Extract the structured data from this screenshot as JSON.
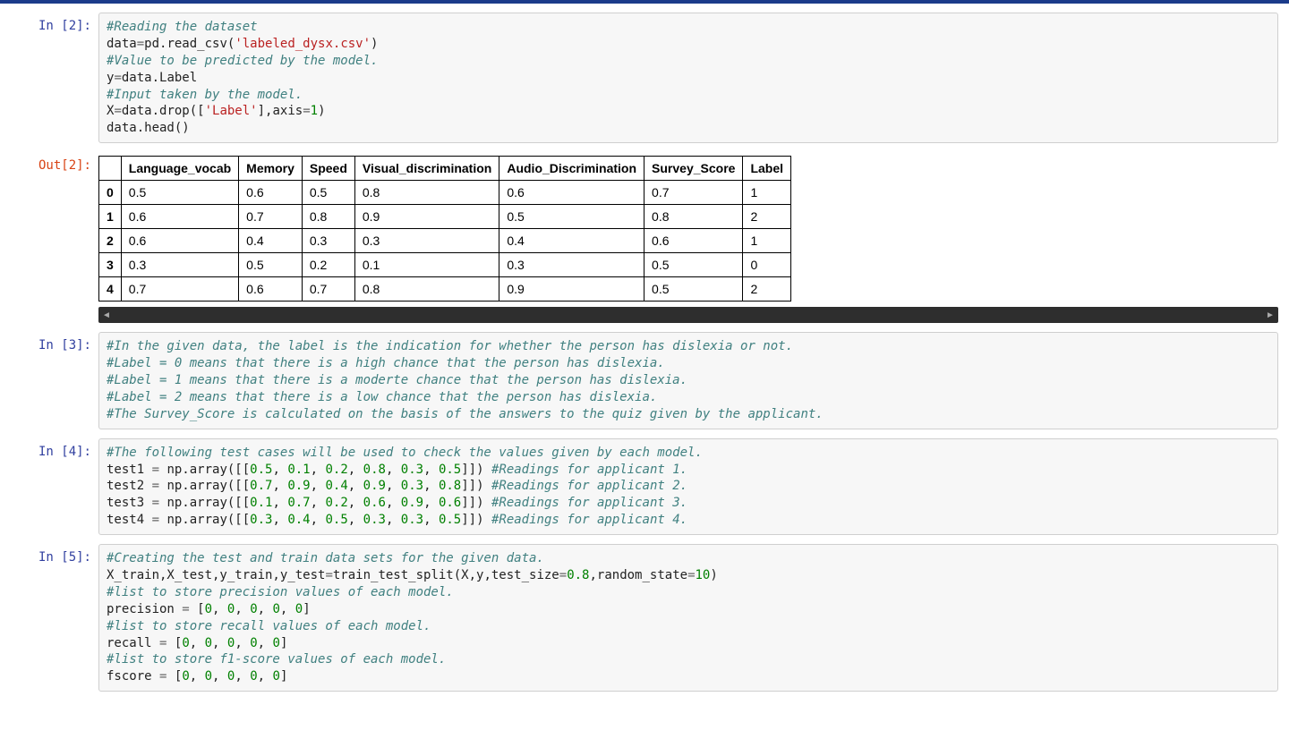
{
  "cells": {
    "in2_prompt": "In [2]:",
    "out2_prompt": "Out[2]:",
    "in3_prompt": "In [3]:",
    "in4_prompt": "In [4]:",
    "in5_prompt": "In [5]:"
  },
  "code2": {
    "l1_comment": "#Reading the dataset",
    "l2_p1": "data",
    "l2_p2": "=",
    "l2_p3": "pd.read_csv(",
    "l2_p4": "'labeled_dysx.csv'",
    "l2_p5": ")",
    "l3_comment": "#Value to be predicted by the model.",
    "l4_p1": "y",
    "l4_p2": "=",
    "l4_p3": "data.Label",
    "l5_comment": "#Input taken by the model.",
    "l6_p1": "X",
    "l6_p2": "=",
    "l6_p3": "data.drop([",
    "l6_p4": "'Label'",
    "l6_p5": "],axis",
    "l6_p6": "=",
    "l6_p7": "1",
    "l6_p8": ")",
    "l7_p1": "data.head()"
  },
  "dataframe": {
    "columns": [
      "Language_vocab",
      "Memory",
      "Speed",
      "Visual_discrimination",
      "Audio_Discrimination",
      "Survey_Score",
      "Label"
    ],
    "index": [
      "0",
      "1",
      "2",
      "3",
      "4"
    ],
    "rows": [
      [
        "0.5",
        "0.6",
        "0.5",
        "0.8",
        "0.6",
        "0.7",
        "1"
      ],
      [
        "0.6",
        "0.7",
        "0.8",
        "0.9",
        "0.5",
        "0.8",
        "2"
      ],
      [
        "0.6",
        "0.4",
        "0.3",
        "0.3",
        "0.4",
        "0.6",
        "1"
      ],
      [
        "0.3",
        "0.5",
        "0.2",
        "0.1",
        "0.3",
        "0.5",
        "0"
      ],
      [
        "0.7",
        "0.6",
        "0.7",
        "0.8",
        "0.9",
        "0.5",
        "2"
      ]
    ]
  },
  "code3": {
    "l1": "#In the given data, the label is the indication for whether the person has dislexia or not.",
    "l2": "#Label = 0 means that there is a high chance that the person has dislexia.",
    "l3": "#Label = 1 means that there is a moderte chance that the person has dislexia.",
    "l4": "#Label = 2 means that there is a low chance that the person has dislexia.",
    "l5": "#The Survey_Score is calculated on the basis of the answers to the quiz given by the applicant."
  },
  "code4": {
    "l1_comment": "#The following test cases will be used to check the values given by each model.",
    "l2_p1": "test1 ",
    "l2_p2": "=",
    "l2_p3": " np.array([[",
    "l2_n1": "0.5",
    "l2_c": ", ",
    "l2_n2": "0.1",
    "l2_n3": "0.2",
    "l2_n4": "0.8",
    "l2_n5": "0.3",
    "l2_n6": "0.5",
    "l2_p4": "]]) ",
    "l2_comment": "#Readings for applicant 1.",
    "l3_p1": "test2 ",
    "l3_n1": "0.7",
    "l3_n2": "0.9",
    "l3_n3": "0.4",
    "l3_n4": "0.9",
    "l3_n5": "0.3",
    "l3_n6": "0.8",
    "l3_comment": "#Readings for applicant 2.",
    "l4_p1": "test3 ",
    "l4_n1": "0.1",
    "l4_n2": "0.7",
    "l4_n3": "0.2",
    "l4_n4": "0.6",
    "l4_n5": "0.9",
    "l4_n6": "0.6",
    "l4_comment": "#Readings for applicant 3.",
    "l5_p1": "test4 ",
    "l5_n1": "0.3",
    "l5_n2": "0.4",
    "l5_n3": "0.5",
    "l5_n4": "0.3",
    "l5_n5": "0.3",
    "l5_n6": "0.5",
    "l5_comment": "#Readings for applicant 4."
  },
  "code5": {
    "l1_comment": "#Creating the test and train data sets for the given data.",
    "l2_p1": "X_train,X_test,y_train,y_test",
    "l2_p2": "=",
    "l2_p3": "train_test_split(X,y,test_size",
    "l2_p4": "=",
    "l2_p5": "0.8",
    "l2_p6": ",random_state",
    "l2_p7": "=",
    "l2_p8": "10",
    "l2_p9": ")",
    "l3_comment": "#list to store precision values of each model.",
    "l4_p1": "precision ",
    "l4_p2": "=",
    "l4_p3": " [",
    "l4_n1": "0",
    "l4_c": ", ",
    "l4_p4": "]",
    "l5_comment": "#list to store recall values of each model.",
    "l6_p1": "recall ",
    "l6_p2": "=",
    "l6_p3": " [",
    "l7_comment": "#list to store f1-score values of each model.",
    "l8_p1": "fscore ",
    "l8_p2": "=",
    "l8_p3": " ["
  },
  "scroll": {
    "left_glyph": "◄",
    "right_glyph": "►"
  },
  "chart_data": {
    "type": "table",
    "title": "data.head()",
    "columns": [
      "Language_vocab",
      "Memory",
      "Speed",
      "Visual_discrimination",
      "Audio_Discrimination",
      "Survey_Score",
      "Label"
    ],
    "index": [
      0,
      1,
      2,
      3,
      4
    ],
    "rows": [
      [
        0.5,
        0.6,
        0.5,
        0.8,
        0.6,
        0.7,
        1
      ],
      [
        0.6,
        0.7,
        0.8,
        0.9,
        0.5,
        0.8,
        2
      ],
      [
        0.6,
        0.4,
        0.3,
        0.3,
        0.4,
        0.6,
        1
      ],
      [
        0.3,
        0.5,
        0.2,
        0.1,
        0.3,
        0.5,
        0
      ],
      [
        0.7,
        0.6,
        0.7,
        0.8,
        0.9,
        0.5,
        2
      ]
    ]
  }
}
